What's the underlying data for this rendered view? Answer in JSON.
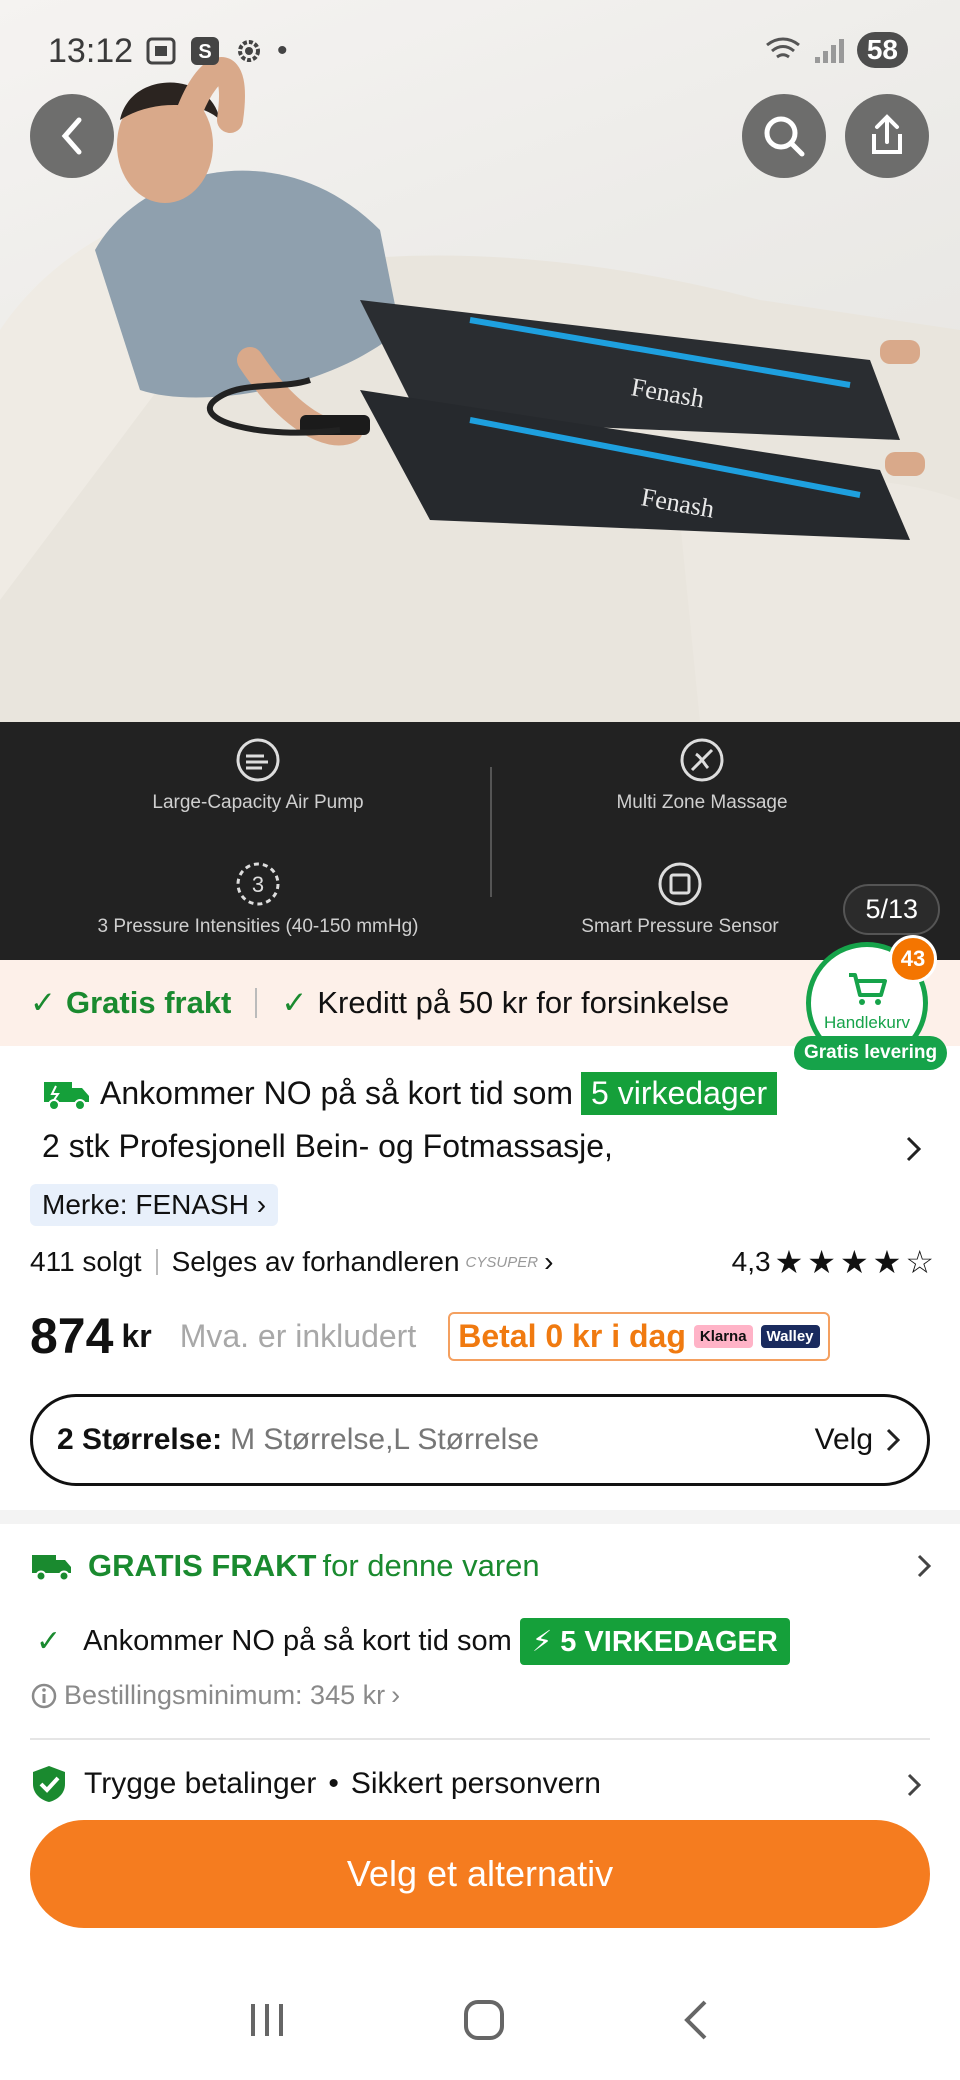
{
  "status_bar": {
    "time": "13:12",
    "battery": "58"
  },
  "gallery": {
    "counter": "5/13",
    "features": [
      {
        "label": "Large-Capacity Air Pump",
        "icon": "air-pump-icon"
      },
      {
        "label": "Multi  Zone Massage",
        "icon": "massage-zone-icon"
      },
      {
        "label": "3 Pressure Intensities (40-150 mmHg)",
        "icon": "pressure-icon"
      },
      {
        "label": "Smart Pressure Sensor",
        "icon": "sensor-chip-icon"
      }
    ],
    "brand_print": "Fenash"
  },
  "cart": {
    "count": "43",
    "label": "Handlekurv",
    "free_delivery": "Gratis levering"
  },
  "promo": {
    "free_shipping": "Gratis frakt",
    "credit": "Kreditt på 50 kr for forsinkelse"
  },
  "product": {
    "arrival_text": "Ankommer NO på så kort tid som",
    "arrival_badge": "5 virkedager",
    "title": "2 stk Profesjonell Bein- og Fotmassasje,",
    "brand": "Merke: FENASH",
    "sold": "411 solgt",
    "seller": "Selges av forhandleren",
    "seller_logo": "CYSUPER",
    "rating": "4,3",
    "rating_stars": 4.3,
    "price": "874",
    "currency": "kr",
    "vat_note": "Mva. er inkludert",
    "pay_today": "Betal 0 kr i dag",
    "pay_providers": [
      "Klarna",
      "Walley"
    ]
  },
  "size_selector": {
    "label": "2 Størrelse:",
    "value": "M Størrelse,L Størrelse",
    "action": "Velg"
  },
  "shipping": {
    "title_bold": "GRATIS FRAKT",
    "title_rest": "for denne varen",
    "arrival_text": "Ankommer NO på så kort tid som",
    "arrival_badge": "5 VIRKEDAGER",
    "min_order": "Bestillingsminimum: 345 kr"
  },
  "security": {
    "payments": "Trygge betalinger",
    "privacy": "Sikkert personvern"
  },
  "cta": {
    "label": "Velg et alternativ"
  },
  "colors": {
    "accent": "#f57c1f",
    "green": "#1a8a2f",
    "badge_green": "#15a03a"
  }
}
